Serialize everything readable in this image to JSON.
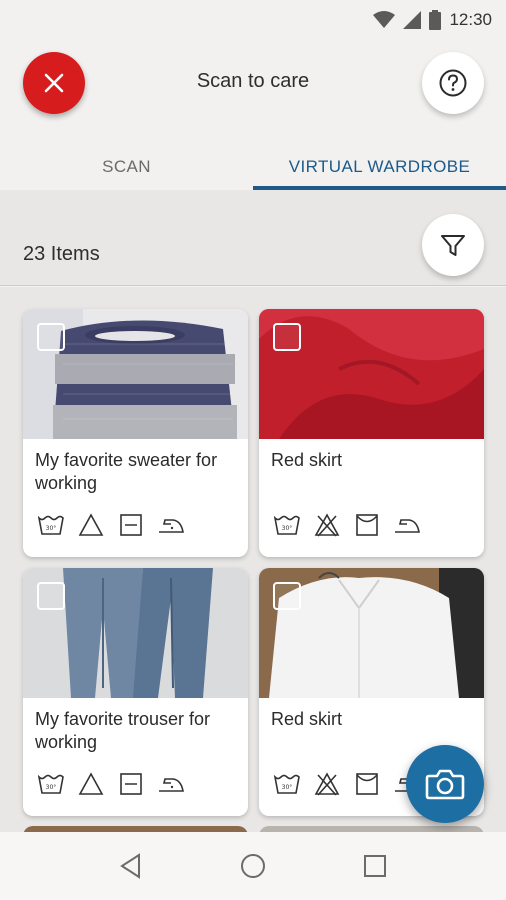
{
  "statusbar": {
    "time": "12:30",
    "icons": [
      "wifi-icon",
      "signal-icon",
      "battery-icon"
    ]
  },
  "appbar": {
    "title": "Scan to care",
    "close_icon": "close-icon",
    "help_icon": "help-icon"
  },
  "tabs": [
    {
      "label": "SCAN",
      "active": false
    },
    {
      "label": "VIRTUAL WARDROBE",
      "active": true
    }
  ],
  "toolbar": {
    "items_count": "23 Items",
    "filter_icon": "filter-icon"
  },
  "items": [
    {
      "name": "My favorite sweater for working",
      "image": "sweater",
      "care": [
        "wash-30",
        "bleach-any",
        "dry-flat",
        "iron-low"
      ]
    },
    {
      "name": "Red skirt",
      "image": "red-fabric",
      "care": [
        "wash-30",
        "no-bleach",
        "line-dry",
        "iron-low"
      ]
    },
    {
      "name": "My favorite trouser for working",
      "image": "jeans",
      "care": [
        "wash-30",
        "bleach-any",
        "dry-flat",
        "iron-low"
      ]
    },
    {
      "name": "Red skirt",
      "image": "white-shirt",
      "care": [
        "wash-30",
        "no-bleach",
        "line-dry",
        "iron-low"
      ]
    }
  ],
  "fab": {
    "icon": "camera-icon"
  },
  "navbar": {
    "icons": [
      "back-icon",
      "home-icon",
      "recents-icon"
    ]
  },
  "colors": {
    "accent": "#1d5a8a",
    "close": "#d71c1e",
    "fab": "#1d6ea3"
  }
}
